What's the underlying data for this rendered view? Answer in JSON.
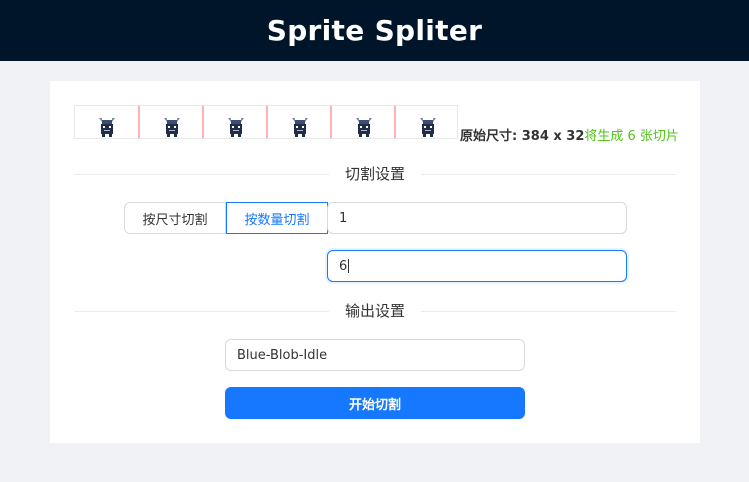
{
  "app": {
    "title": "Sprite Spliter"
  },
  "preview": {
    "frames": [
      "frame-1",
      "frame-2",
      "frame-3",
      "frame-4",
      "frame-5",
      "frame-6"
    ],
    "original_size_label": "原始尺寸: 384 x 32",
    "slice_count_label": "将生成 6 张切片",
    "accent_color": "#52c41a"
  },
  "split_settings": {
    "section_title": "切割设置",
    "modes": [
      "按尺寸切割",
      "按数量切割"
    ],
    "active_mode": "按数量切割",
    "rows_value": "1",
    "cols_value": "6"
  },
  "output_settings": {
    "section_title": "输出设置",
    "filename_value": "Blue-Blob-Idle",
    "start_button_label": "开始切割",
    "primary_color": "#1677ff"
  }
}
